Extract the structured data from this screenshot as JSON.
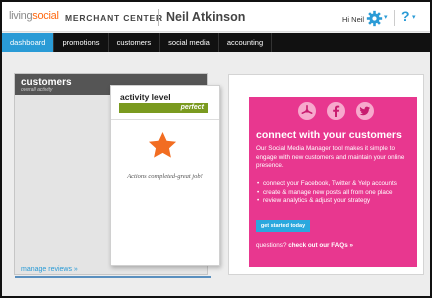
{
  "header": {
    "logo_part1": "living",
    "logo_part2": "social",
    "section": "MERCHANT CENTER",
    "business_name": "Neil Atkinson",
    "greeting": "Hi Neil",
    "settings_icon": "gear-icon",
    "help_icon": "help-icon",
    "help_glyph": "?",
    "caret_glyph": "▾"
  },
  "nav": {
    "items": [
      "dashboard",
      "promotions",
      "customers",
      "social media",
      "accounting"
    ],
    "active": "dashboard"
  },
  "customers": {
    "title": "customers",
    "subtitle": "overall activity",
    "manage_link": "manage reviews »"
  },
  "activity": {
    "title": "activity level",
    "level": "perfect",
    "level_fraction": 1.0,
    "star_icon": "star-icon",
    "message": "Actions completed-great job!"
  },
  "connect": {
    "icons": [
      "yelp-icon",
      "facebook-icon",
      "twitter-icon"
    ],
    "title": "connect with your customers",
    "description": "Our Social Media Manager tool makes it simple to engage with new customers and maintain your online presence.",
    "bullets": [
      "connect your Facebook, Twitter & Yelp accounts",
      "create & manage new posts all from one place",
      "review analytics & adjust your strategy"
    ],
    "button": "get started today",
    "faq_prefix": "questions?",
    "faq_link": "check out our FAQs »",
    "color": "#e8378f"
  },
  "colors": {
    "accent": "#2a9bd6",
    "perfect": "#7a9a1f",
    "star": "#f26d21"
  }
}
